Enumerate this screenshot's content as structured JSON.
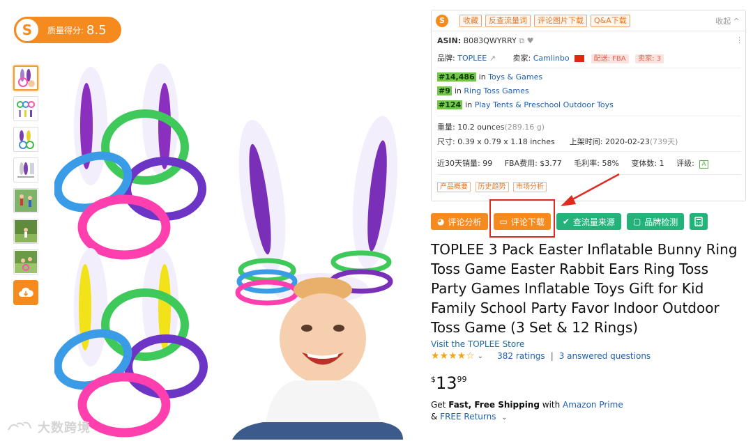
{
  "score": {
    "label": "质量得分:",
    "value": "8.5"
  },
  "panel": {
    "buttons": [
      "收藏",
      "反查流量词",
      "评论图片下载",
      "Q&A下载"
    ],
    "collapse": "收起 ^",
    "asin_label": "ASIN:",
    "asin": "B083QWYRRY",
    "brand_label": "品牌:",
    "brand": "TOPLEE",
    "seller_label": "卖家:",
    "seller": "Camlinbo",
    "ship_tag": "配送: FBA",
    "seller_count_tag": "卖家: 3",
    "ranks": [
      {
        "rank": "#14,486",
        "in": "in",
        "category": "Toys & Games"
      },
      {
        "rank": "#9",
        "in": "in",
        "category": "Ring Toss Games"
      },
      {
        "rank": "#124",
        "in": "in",
        "category": "Play Tents & Preschool Outdoor Toys"
      }
    ],
    "weight_label": "重量:",
    "weight": "10.2 ounces",
    "weight_g": "(289.16 g)",
    "size_label": "尺寸:",
    "size": "0.39 x 0.79 x 1.18 inches",
    "listed_label": "上架时间:",
    "listed": "2020-02-23",
    "listed_days": "(739天)",
    "sales_label": "近30天销量:",
    "sales": "99",
    "fba_label": "FBA费用:",
    "fba": "$3.77",
    "margin_label": "毛利率:",
    "margin": "58%",
    "variants_label": "变体数:",
    "variants": "1",
    "grade_label": "评级:",
    "grade": "A",
    "tabs": [
      "产品概要",
      "历史趋势",
      "市场分析"
    ]
  },
  "actions": [
    {
      "label": "评论分析",
      "color": "#f58a1f"
    },
    {
      "label": "评论下载",
      "color": "#f58a1f"
    },
    {
      "label": "查流量来源",
      "color": "#22b27a"
    },
    {
      "label": "品牌检测",
      "color": "#22b27a"
    }
  ],
  "product": {
    "title": "TOPLEE 3 Pack Easter Inflatable Bunny Ring Toss Game Easter Rabbit Ears Ring Toss Party Games Inflatable Toys Gift for Kid Family School Party Favor Indoor Outdoor Toss Game (3 Set & 12 Rings)",
    "store": "Visit the TOPLEE Store",
    "stars": "★★★★☆",
    "ratings": "382 ratings",
    "divider": "|",
    "questions": "3 answered questions",
    "price_currency": "$",
    "price_whole": "13",
    "price_fraction": "99",
    "ship_prefix": "Get ",
    "ship_bold": "Fast, Free Shipping",
    "ship_with": " with ",
    "ship_prime": "Amazon Prime",
    "returns_prefix": "& ",
    "returns": "FREE Returns"
  },
  "watermark": "大数跨境"
}
